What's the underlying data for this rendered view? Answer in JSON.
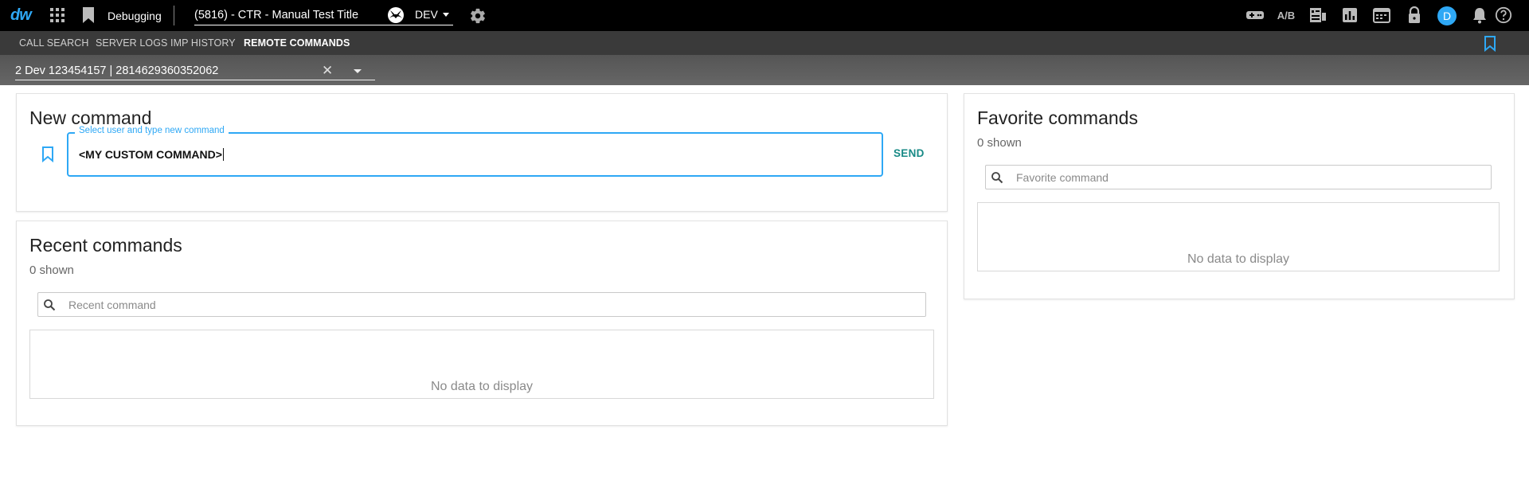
{
  "app": {
    "logo": "dw",
    "section": "Debugging",
    "title_selector": "(5816) - CTR - Manual Test Title",
    "environment": "DEV",
    "avatar_initial": "D",
    "ab_label": "A/B"
  },
  "nav": {
    "tabs": [
      {
        "label": "CALL SEARCH"
      },
      {
        "label": "SERVER LOGS"
      },
      {
        "label": "IMP HISTORY"
      },
      {
        "label": "REMOTE COMMANDS"
      }
    ],
    "active_tab": "REMOTE COMMANDS"
  },
  "device": {
    "selected": "2 Dev 123454157 | 2814629360352062"
  },
  "new_command": {
    "title": "New command",
    "field_label": "Select user and type new command",
    "value": "<MY CUSTOM COMMAND>",
    "send_label": "SEND"
  },
  "recent_commands": {
    "title": "Recent commands",
    "count_text": "0 shown",
    "search_placeholder": "Recent command",
    "empty_text": "No data to display"
  },
  "favorite_commands": {
    "title": "Favorite commands",
    "count_text": "0 shown",
    "search_placeholder": "Favorite command",
    "empty_text": "No data to display"
  },
  "colors": {
    "accent": "#2ea8f5",
    "send": "#188a86",
    "topbar": "#000000",
    "navbar": "#3a3a3a"
  }
}
